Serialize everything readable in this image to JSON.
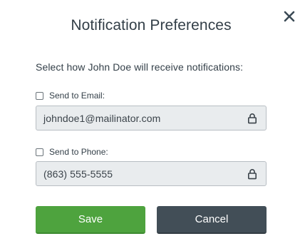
{
  "dialog": {
    "title": "Notification Preferences",
    "close_icon": "close-icon",
    "instruction": "Select how John Doe will receive notifications:"
  },
  "email": {
    "checkbox_label": "Send to Email:",
    "checked": false,
    "value": "johndoe1@mailinator.com",
    "locked": true,
    "lock_icon": "lock-icon"
  },
  "phone": {
    "checkbox_label": "Send to Phone:",
    "checked": false,
    "value": "(863) 555-5555",
    "locked": true,
    "lock_icon": "lock-icon"
  },
  "actions": {
    "save_label": "Save",
    "cancel_label": "Cancel"
  },
  "colors": {
    "save": "#4ea33e",
    "cancel": "#424e57",
    "field_bg": "#e9ecee",
    "text": "#333f48"
  }
}
